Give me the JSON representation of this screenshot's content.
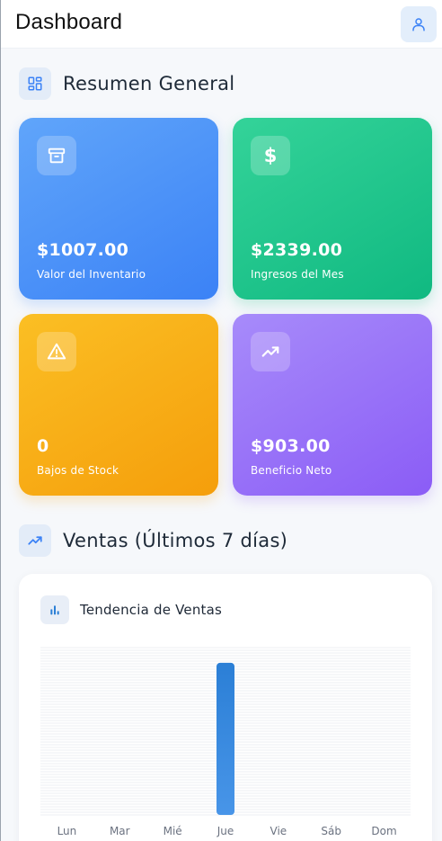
{
  "header": {
    "title": "Dashboard",
    "profile_icon": "user-icon"
  },
  "summary": {
    "title": "Resumen General",
    "icon": "grid-icon",
    "cards": [
      {
        "value": "$1007.00",
        "label": "Valor del Inventario",
        "icon": "archive-icon",
        "color": "#3b82f6"
      },
      {
        "value": "$2339.00",
        "label": "Ingresos del Mes",
        "icon": "dollar-icon",
        "color": "#10b981"
      },
      {
        "value": "0",
        "label": "Bajos de Stock",
        "icon": "warning-icon",
        "color": "#f59e0b"
      },
      {
        "value": "$903.00",
        "label": "Beneficio Neto",
        "icon": "trending-up-icon",
        "color": "#8b5cf6"
      }
    ]
  },
  "sales": {
    "title": "Ventas (Últimos 7 días)",
    "icon": "trending-up-icon",
    "chart_title": "Tendencia de Ventas",
    "chart_icon": "bar-chart-icon"
  },
  "chart_data": {
    "type": "bar",
    "title": "Tendencia de Ventas",
    "categories": [
      "Lun",
      "Mar",
      "Mié",
      "Jue",
      "Vie",
      "Sáb",
      "Dom"
    ],
    "values": [
      0,
      0,
      0,
      1,
      0,
      0,
      0
    ],
    "ylim": [
      0,
      1.1
    ],
    "grid": true,
    "bar_color": "#2b7fd6"
  }
}
